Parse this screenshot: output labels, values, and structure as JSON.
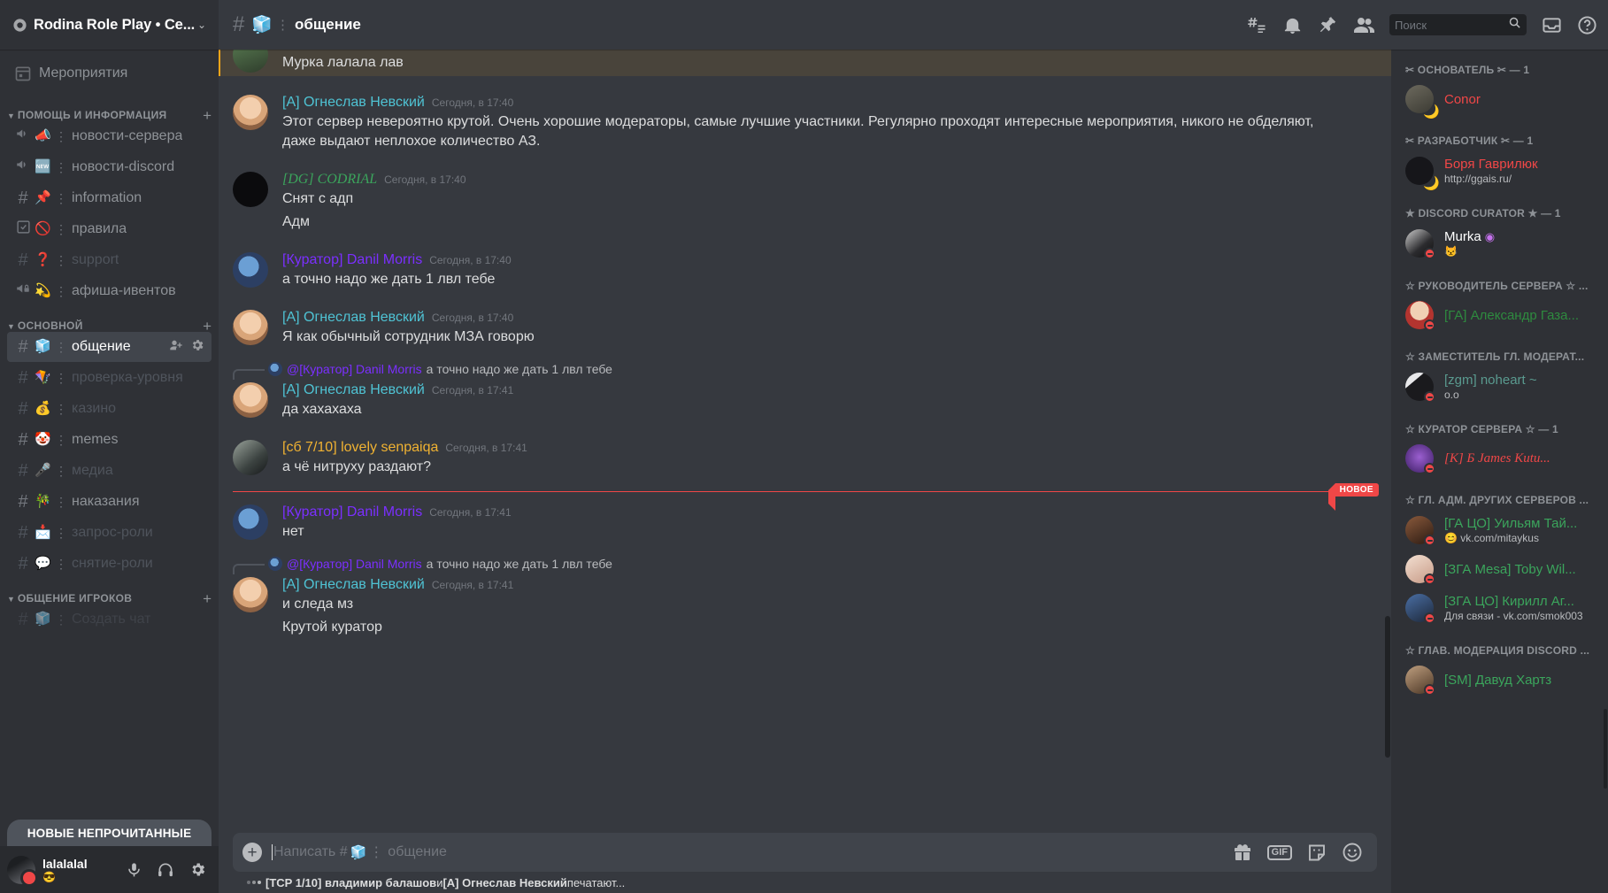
{
  "sidebar": {
    "server_name": "Rodina Role Play • Ce...",
    "server_icon": "gear-circle-icon",
    "events_label": "Мероприятия",
    "unread_banner": "НОВЫЕ НЕПРОЧИТАННЫЕ",
    "categories": [
      {
        "label": "ПОМОЩЬ И ИНФОРМАЦИЯ",
        "channels": [
          {
            "name": "новости-сервера",
            "icon": "announcement-icon",
            "emoji": "📣",
            "muted": false,
            "active": false
          },
          {
            "name": "новости-discord",
            "icon": "announcement-icon",
            "emoji": "🆕",
            "muted": false,
            "active": false
          },
          {
            "name": "information",
            "icon": "hash-icon",
            "emoji": "📌",
            "muted": false,
            "active": false
          },
          {
            "name": "правила",
            "icon": "rules-icon",
            "emoji": "🚫",
            "muted": false,
            "active": false
          },
          {
            "name": "support",
            "icon": "hash-icon",
            "emoji": "❓",
            "muted": true,
            "active": false
          },
          {
            "name": "афиша-ивентов",
            "icon": "announcement-locked-icon",
            "emoji": "💫",
            "muted": false,
            "active": false
          }
        ]
      },
      {
        "label": "ОСНОВНОЙ",
        "channels": [
          {
            "name": "общение",
            "icon": "hash-icon",
            "emoji": "🧊",
            "muted": false,
            "active": true
          },
          {
            "name": "проверка-уровня",
            "icon": "hash-icon",
            "emoji": "🪁",
            "muted": true,
            "active": false
          },
          {
            "name": "казино",
            "icon": "hash-icon",
            "emoji": "💰",
            "muted": true,
            "active": false
          },
          {
            "name": "memes",
            "icon": "hash-icon",
            "emoji": "🤡",
            "muted": false,
            "active": false
          },
          {
            "name": "медиа",
            "icon": "hash-icon",
            "emoji": "🎤",
            "muted": true,
            "active": false
          },
          {
            "name": "наказания",
            "icon": "hash-icon",
            "emoji": "🎋",
            "muted": false,
            "active": false
          },
          {
            "name": "запрос-роли",
            "icon": "hash-icon",
            "emoji": "📩",
            "muted": true,
            "active": false
          },
          {
            "name": "снятие-роли",
            "icon": "hash-icon",
            "emoji": "💬",
            "muted": true,
            "active": false
          }
        ]
      },
      {
        "label": "ОБЩЕНИЕ ИГРОКОВ",
        "channels": []
      }
    ]
  },
  "user_panel": {
    "name": "lalalalal",
    "status_emoji": "😎",
    "mic_icon": "microphone-icon",
    "headphones_icon": "headphones-icon",
    "settings_icon": "gear-icon"
  },
  "header": {
    "hash": "#",
    "emoji": "🧊",
    "colon": "⋮",
    "title": "общение",
    "icons": [
      "threads-icon",
      "bell-icon",
      "pin-icon",
      "members-icon",
      "inbox-icon",
      "help-icon"
    ]
  },
  "search": {
    "placeholder": "Поиск",
    "value": "",
    "icon": "search-icon"
  },
  "messages": [
    {
      "type": "partial_top",
      "author": "",
      "time": "",
      "text": "Мурка лалала лав",
      "color": "#dcddde",
      "avatar_style": "a-green"
    },
    {
      "type": "full",
      "author": "[A] Огнеслав Невский",
      "time": "Сегодня, в 17:40",
      "color": "#4fc3d4",
      "avatar_style": "a-ognes",
      "text": "Этот сервер невероятно крутой. Очень хорошие модераторы, самые лучшие участники. Регулярно проходят интересные мероприятия, никого не обделяют, даже выдают неплохое количество АЗ."
    },
    {
      "type": "full",
      "author": "[DG] CODRIAL",
      "time": "Сегодня, в 17:40",
      "color": "#3ba55c",
      "avatar_style": "a-codrial",
      "italic": true,
      "text": "Снят с адп",
      "text2": "Адм"
    },
    {
      "type": "full",
      "author": "[Куратор] Danil Morris",
      "time": "Сегодня, в 17:40",
      "color": "#7b2fff",
      "avatar_style": "a-danil",
      "text": "а точно надо же дать 1 лвл тебе"
    },
    {
      "type": "full",
      "author": "[A] Огнеслав Невский",
      "time": "Сегодня, в 17:40",
      "color": "#4fc3d4",
      "avatar_style": "a-ognes",
      "text": "Я как обычный сотрудник МЗА говорю"
    },
    {
      "type": "reply",
      "reply_to_name": "@[Куратор] Danil Morris",
      "reply_to_color": "#7b2fff",
      "reply_to_text": "а точно надо же дать 1 лвл тебе",
      "reply_avatar_style": "a-danil",
      "author": "[A] Огнеслав Невский",
      "time": "Сегодня, в 17:41",
      "color": "#4fc3d4",
      "avatar_style": "a-ognes",
      "text": "да хахахаха"
    },
    {
      "type": "full",
      "author": "[сб 7/10] lovely senpaiqa",
      "time": "Сегодня, в 17:41",
      "color": "#f0b232",
      "avatar_style": "a-senpaiqa",
      "text": "а чё нитруху раздают?"
    },
    {
      "type": "divider",
      "badge": "НОВОЕ"
    },
    {
      "type": "full",
      "author": "[Куратор] Danil Morris",
      "time": "Сегодня, в 17:41",
      "color": "#7b2fff",
      "avatar_style": "a-danil",
      "text": "нет"
    },
    {
      "type": "reply",
      "reply_to_name": "@[Куратор] Danil Morris",
      "reply_to_color": "#7b2fff",
      "reply_to_text": "а точно надо же дать 1 лвл тебе",
      "reply_avatar_style": "a-danil",
      "author": "[A] Огнеслав Невский",
      "time": "Сегодня, в 17:41",
      "color": "#4fc3d4",
      "avatar_style": "a-ognes",
      "text": "и следа мз",
      "text2": "Крутой куратор"
    }
  ],
  "composer": {
    "placeholder_prefix": "Написать #",
    "placeholder_emoji": "🧊",
    "placeholder_colon": "⋮",
    "placeholder_channel": "общение",
    "plus_icon": "plus-icon",
    "gift_icon": "gift-icon",
    "gif_label": "GIF",
    "sticker_icon": "sticker-icon",
    "emoji_icon": "emoji-icon"
  },
  "typing": {
    "user1": "[TCP 1/10] владимир балашов",
    "conj": " и ",
    "user2": "[A] Огнеслав Невский",
    "suffix": " печатают..."
  },
  "members": [
    {
      "category": "✂ ОСНОВАТЕЛЬ ✂ — 1",
      "list": [
        {
          "name": "Conor",
          "color": "#f04747",
          "sub": "",
          "status": "idle",
          "avatar_style": "m-conor"
        }
      ]
    },
    {
      "category": "✂ РАЗРАБОТЧИК ✂ — 1",
      "list": [
        {
          "name": "Боря Гаврилюк",
          "color": "#f04747",
          "sub": "http://ggais.ru/",
          "status": "idle",
          "avatar_style": "m-borya"
        }
      ]
    },
    {
      "category": "★ DISCORD CURATOR ★ — 1",
      "list": [
        {
          "name": "Murka",
          "color": "#ffffff",
          "badge": "◉",
          "sub": "😾",
          "status": "dnd",
          "avatar_style": "m-murka"
        }
      ]
    },
    {
      "category": "☆ РУКОВОДИТЕЛЬ СЕРВЕРА ☆ ...",
      "list": [
        {
          "name": "[ГА] Александр Газа...",
          "color": "#2e8b3f",
          "sub": "",
          "status": "dnd",
          "avatar_style": "m-alex"
        }
      ]
    },
    {
      "category": "☆ ЗАМЕСТИТЕЛЬ ГЛ. МОДЕРАТ...",
      "list": [
        {
          "name": "[zgm] noheart ~",
          "color": "#5a9a8f",
          "sub": "o.o",
          "status": "dnd",
          "avatar_style": "m-noheart"
        }
      ]
    },
    {
      "category": "☆ КУРАТОР СЕРВЕРА ☆ — 1",
      "list": [
        {
          "name": "[K] Ƃ James Kutu...",
          "color": "#f04747",
          "sub": "",
          "status": "dnd",
          "avatar_style": "m-james",
          "italic": true
        }
      ]
    },
    {
      "category": "☆ ГЛ. АДМ. ДРУГИХ СЕРВЕРОВ ...",
      "list": [
        {
          "name": "[ГА ЦО] Уильям Тай...",
          "color": "#3ba55c",
          "sub": "😊 vk.com/mitaykus",
          "status": "dnd",
          "avatar_style": "m-william"
        },
        {
          "name": "[ЗГА Mesa] Toby Wil...",
          "color": "#3ba55c",
          "sub": "",
          "status": "dnd",
          "avatar_style": "m-toby"
        },
        {
          "name": "[ЗГА ЦО] Кирилл Аг...",
          "color": "#3ba55c",
          "sub": "Для связи - vk.com/smok003",
          "status": "dnd",
          "avatar_style": "m-kirill"
        }
      ]
    },
    {
      "category": "☆ ГЛАВ. МОДЕРАЦИЯ DISCORD ...",
      "list": [
        {
          "name": "[SM] Давуд Хартз",
          "color": "#3ba55c",
          "sub": "",
          "status": "dnd",
          "avatar_style": "m-davud"
        }
      ]
    }
  ]
}
